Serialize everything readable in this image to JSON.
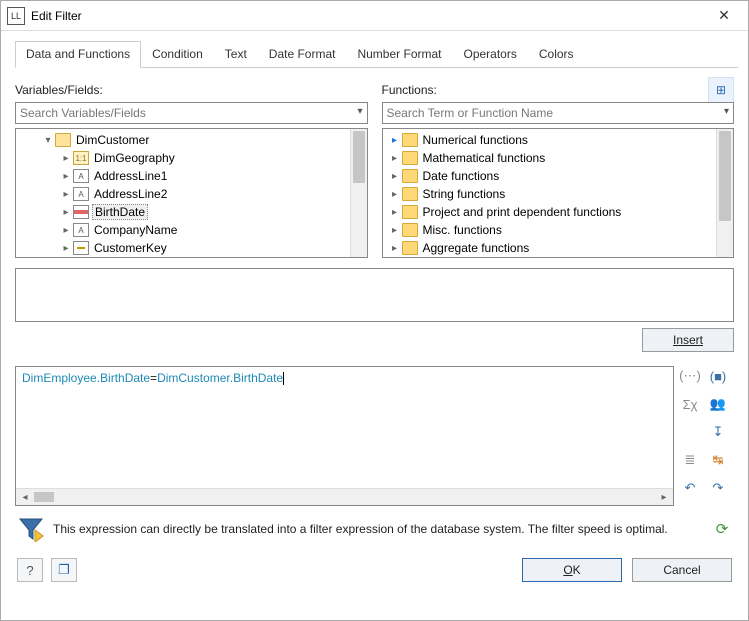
{
  "window": {
    "app_icon_text": "LL",
    "title": "Edit Filter"
  },
  "tabs": [
    {
      "label": "Data and Functions",
      "active": true
    },
    {
      "label": "Condition"
    },
    {
      "label": "Text"
    },
    {
      "label": "Date Format"
    },
    {
      "label": "Number Format"
    },
    {
      "label": "Operators"
    },
    {
      "label": "Colors"
    }
  ],
  "left_panel": {
    "heading": "Variables/Fields:",
    "search_placeholder": "Search Variables/Fields",
    "tree": [
      {
        "depth": 1,
        "expander": "open",
        "icon": "folder-open",
        "label": "DimCustomer"
      },
      {
        "depth": 2,
        "expander": "closed",
        "icon": "rel",
        "label": "DimGeography"
      },
      {
        "depth": 2,
        "expander": "closed",
        "icon": "A",
        "label": "AddressLine1"
      },
      {
        "depth": 2,
        "expander": "closed",
        "icon": "A",
        "label": "AddressLine2"
      },
      {
        "depth": 2,
        "expander": "closed",
        "icon": "date",
        "label": "BirthDate",
        "selected": true
      },
      {
        "depth": 2,
        "expander": "closed",
        "icon": "A",
        "label": "CompanyName"
      },
      {
        "depth": 2,
        "expander": "closed",
        "icon": "key",
        "label": "CustomerKey"
      }
    ]
  },
  "right_panel": {
    "heading": "Functions:",
    "search_placeholder": "Search Term or Function Name",
    "tree": [
      {
        "expander": "closed-blue",
        "icon": "folder",
        "label": "Numerical functions"
      },
      {
        "expander": "closed",
        "icon": "folder",
        "label": "Mathematical functions"
      },
      {
        "expander": "closed",
        "icon": "folder",
        "label": "Date functions"
      },
      {
        "expander": "closed",
        "icon": "folder",
        "label": "String functions"
      },
      {
        "expander": "closed",
        "icon": "folder",
        "label": "Project and print dependent functions"
      },
      {
        "expander": "closed",
        "icon": "folder",
        "label": "Misc. functions"
      },
      {
        "expander": "closed",
        "icon": "folder",
        "label": "Aggregate functions"
      }
    ]
  },
  "buttons": {
    "insert": "Insert",
    "ok": "OK",
    "cancel": "Cancel"
  },
  "expression": {
    "part1": "DimEmployee.BirthDate",
    "op": "=",
    "part2": "DimCustomer.BirthDate"
  },
  "status": {
    "text": "This expression can directly be translated into a filter expression of the database system. The filter speed is optimal."
  },
  "side_tools": {
    "r1a": "(⋯)",
    "r1b": "(■)",
    "r2a": "Σχ",
    "r2b": "👥",
    "r3": "↧",
    "r4a": "≣",
    "r4b": "↹",
    "r5a": "↶",
    "r5b": "↷"
  },
  "footer_icons": {
    "help": "?",
    "windows": "❐"
  },
  "toolbar_icon": "⊞"
}
